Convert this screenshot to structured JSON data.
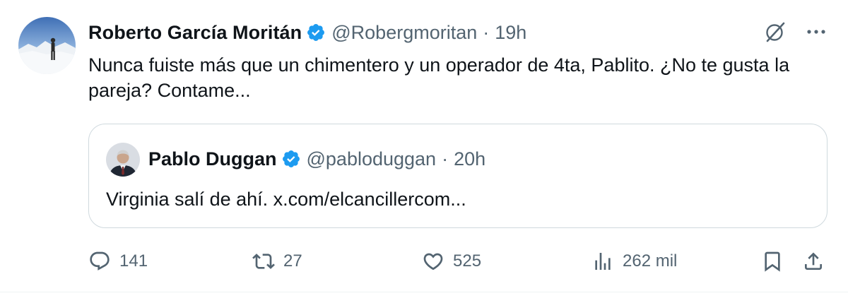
{
  "tweet": {
    "author_name": "Roberto García Moritán",
    "handle": "@Robergmoritan",
    "separator": "·",
    "time": "19h",
    "text": "Nunca fuiste más que un chimentero y un operador de 4ta, Pablito. ¿No te gusta la pareja? Contame...",
    "verified": true
  },
  "quote": {
    "author_name": "Pablo Duggan",
    "handle": "@pabloduggan",
    "separator": "·",
    "time": "20h",
    "text": "Virginia salí de ahí. x.com/elcancillercom...",
    "verified": true
  },
  "actions": {
    "replies": "141",
    "reposts": "27",
    "likes": "525",
    "views": "262 mil"
  },
  "colors": {
    "text_primary": "#0f1419",
    "text_secondary": "#536471",
    "verified_blue": "#1d9bf0",
    "border": "#cfd9de"
  },
  "icons": [
    "verified-badge-icon",
    "grok-icon",
    "more-icon",
    "reply-icon",
    "repost-icon",
    "like-icon",
    "views-icon",
    "bookmark-icon",
    "share-icon"
  ]
}
